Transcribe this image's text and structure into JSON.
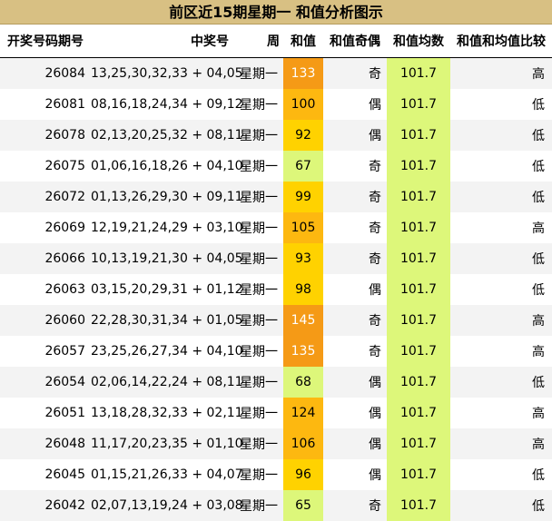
{
  "title": "前区近15期星期一 和值分析图示",
  "headers": {
    "issue": "开奖号码期号",
    "numbers": "中奖号",
    "weekday": "周",
    "sum": "和值",
    "parity": "和值奇偶",
    "avg": "和值均数",
    "compare": "和值和均值比较"
  },
  "colors": {
    "title_bg": "#d8c083",
    "avg_bg": "#ddf77a",
    "sum_high": "#f59a16",
    "sum_mid": "#fdb810",
    "sum_low": "#ffd200",
    "sum_lowest": "#ddf77a"
  },
  "rows": [
    {
      "issue": "26084",
      "numbers": "13,25,30,32,33 + 04,05",
      "weekday": "星期一",
      "sum": "133",
      "parity": "奇",
      "avg": "101.7",
      "compare": "高"
    },
    {
      "issue": "26081",
      "numbers": "08,16,18,24,34 + 09,12",
      "weekday": "星期一",
      "sum": "100",
      "parity": "偶",
      "avg": "101.7",
      "compare": "低"
    },
    {
      "issue": "26078",
      "numbers": "02,13,20,25,32 + 08,11",
      "weekday": "星期一",
      "sum": "92",
      "parity": "偶",
      "avg": "101.7",
      "compare": "低"
    },
    {
      "issue": "26075",
      "numbers": "01,06,16,18,26 + 04,10",
      "weekday": "星期一",
      "sum": "67",
      "parity": "奇",
      "avg": "101.7",
      "compare": "低"
    },
    {
      "issue": "26072",
      "numbers": "01,13,26,29,30 + 09,11",
      "weekday": "星期一",
      "sum": "99",
      "parity": "奇",
      "avg": "101.7",
      "compare": "低"
    },
    {
      "issue": "26069",
      "numbers": "12,19,21,24,29 + 03,10",
      "weekday": "星期一",
      "sum": "105",
      "parity": "奇",
      "avg": "101.7",
      "compare": "高"
    },
    {
      "issue": "26066",
      "numbers": "10,13,19,21,30 + 04,05",
      "weekday": "星期一",
      "sum": "93",
      "parity": "奇",
      "avg": "101.7",
      "compare": "低"
    },
    {
      "issue": "26063",
      "numbers": "03,15,20,29,31 + 01,12",
      "weekday": "星期一",
      "sum": "98",
      "parity": "偶",
      "avg": "101.7",
      "compare": "低"
    },
    {
      "issue": "26060",
      "numbers": "22,28,30,31,34 + 01,05",
      "weekday": "星期一",
      "sum": "145",
      "parity": "奇",
      "avg": "101.7",
      "compare": "高"
    },
    {
      "issue": "26057",
      "numbers": "23,25,26,27,34 + 04,10",
      "weekday": "星期一",
      "sum": "135",
      "parity": "奇",
      "avg": "101.7",
      "compare": "高"
    },
    {
      "issue": "26054",
      "numbers": "02,06,14,22,24 + 08,11",
      "weekday": "星期一",
      "sum": "68",
      "parity": "偶",
      "avg": "101.7",
      "compare": "低"
    },
    {
      "issue": "26051",
      "numbers": "13,18,28,32,33 + 02,11",
      "weekday": "星期一",
      "sum": "124",
      "parity": "偶",
      "avg": "101.7",
      "compare": "高"
    },
    {
      "issue": "26048",
      "numbers": "11,17,20,23,35 + 01,10",
      "weekday": "星期一",
      "sum": "106",
      "parity": "偶",
      "avg": "101.7",
      "compare": "高"
    },
    {
      "issue": "26045",
      "numbers": "01,15,21,26,33 + 04,07",
      "weekday": "星期一",
      "sum": "96",
      "parity": "偶",
      "avg": "101.7",
      "compare": "低"
    },
    {
      "issue": "26042",
      "numbers": "02,07,13,19,24 + 03,08",
      "weekday": "星期一",
      "sum": "65",
      "parity": "奇",
      "avg": "101.7",
      "compare": "低"
    }
  ]
}
